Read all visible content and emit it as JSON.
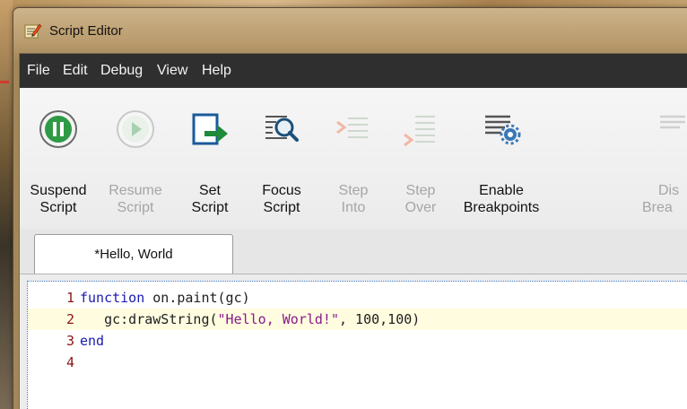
{
  "window": {
    "title": "Script Editor"
  },
  "menu": [
    "File",
    "Edit",
    "Debug",
    "View",
    "Help"
  ],
  "toolbar": {
    "items": [
      {
        "line1": "Suspend",
        "line2": "Script",
        "icon": "pause-icon",
        "enabled": true
      },
      {
        "line1": "Resume",
        "line2": "Script",
        "icon": "play-icon",
        "enabled": false
      },
      {
        "line1": "Set",
        "line2": "Script",
        "icon": "set-script-icon",
        "enabled": true
      },
      {
        "line1": "Focus",
        "line2": "Script",
        "icon": "magnifier-icon",
        "enabled": true
      },
      {
        "line1": "Step",
        "line2": "Into",
        "icon": "step-into-icon",
        "enabled": false
      },
      {
        "line1": "Step",
        "line2": "Over",
        "icon": "step-over-icon",
        "enabled": false
      },
      {
        "line1": "Enable",
        "line2": "Breakpoints",
        "icon": "breakpoints-gear-icon",
        "enabled": true
      },
      {
        "line1": "Dis",
        "line2": "Brea",
        "icon": "disable-breakpoints-icon",
        "enabled": false
      }
    ]
  },
  "tabs": [
    {
      "label": "*Hello, World",
      "active": true
    }
  ],
  "editor": {
    "current_line": 2,
    "lines": [
      {
        "number": "1",
        "tokens": [
          {
            "t": "function",
            "k": "kw"
          },
          {
            "t": " on.paint(gc)",
            "k": ""
          }
        ]
      },
      {
        "number": "2",
        "tokens": [
          {
            "t": "   gc:drawString(",
            "k": ""
          },
          {
            "t": "\"Hello, World!\"",
            "k": "str"
          },
          {
            "t": ", 100,100)",
            "k": ""
          }
        ]
      },
      {
        "number": "3",
        "tokens": [
          {
            "t": "end",
            "k": "kw"
          }
        ]
      },
      {
        "number": "4",
        "tokens": []
      }
    ]
  },
  "colors": {
    "menubar": "#2f2f2f",
    "keyword": "#1a1ab0",
    "string": "#8a1a8a",
    "line_number": "#8a1515",
    "current_line": "#fffce0",
    "disabled_text": "#a5a5a5"
  }
}
